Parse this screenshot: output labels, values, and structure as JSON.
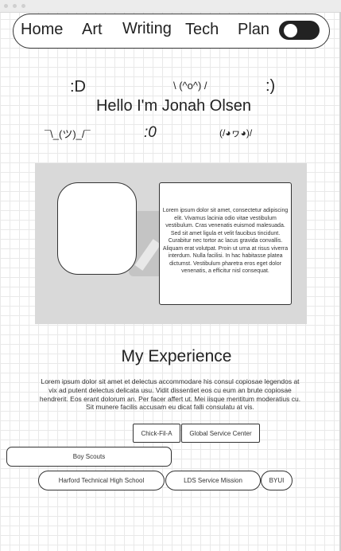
{
  "nav": {
    "links": [
      "Home",
      "Art",
      "Writing",
      "Tech",
      "Plan"
    ],
    "theme_toggle": "off"
  },
  "emoticons": [
    ":D",
    "\\ (^o^) /",
    ":)",
    "¯\\_(ツ)_/¯",
    ":0",
    "(/◕ヮ◕)/"
  ],
  "greeting": "Hello I'm Jonah Olsen",
  "hero": {
    "bio": "Lorem ipsum dolor sit amet, consectetur adipiscing elit. Vivamus lacinia odio vitae vestibulum vestibulum. Cras venenatis euismod malesuada. Sed sit amet ligula et velit faucibus tincidunt. Curabitur nec tortor ac lacus gravida convallis. Aliquam erat volutpat. Proin ut urna at risus viverra interdum. Nulla facilisi. In hac habitasse platea dictumst. Vestibulum pharetra eros eget dolor venenatis, a efficitur nisl consequat."
  },
  "experience": {
    "title": "My Experience",
    "text": "Lorem ipsum dolor sit amet et delectus accommodare his consul copiosae legendos at vix ad putent delectus delicata usu. Vidit dissentiet eos cu eum an brute copiosae hendrerit. Eos erant dolorum an. Per facer affert ut. Mei iisque mentitum moderatius cu. Sit munere facilis accusam eu dicat falli consulatu at vis.",
    "items": [
      "Chick-Fil-A",
      "Global Service Center",
      "Boy Scouts",
      "Harford Technical High School",
      "LDS Service Mission",
      "BYUI"
    ]
  }
}
